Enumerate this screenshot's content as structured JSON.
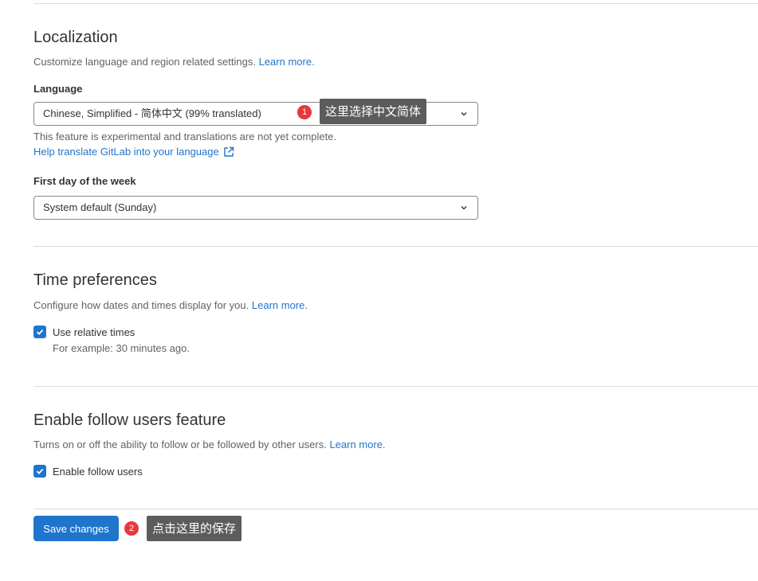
{
  "localization": {
    "title": "Localization",
    "description": "Customize language and region related settings.",
    "learn_more": "Learn more.",
    "language_label": "Language",
    "language_value": "Chinese, Simplified - 简体中文 (99% translated)",
    "experimental_note": "This feature is experimental and translations are not yet complete.",
    "help_translate": "Help translate GitLab into your language",
    "first_day_label": "First day of the week",
    "first_day_value": "System default (Sunday)"
  },
  "time_preferences": {
    "title": "Time preferences",
    "description": "Configure how dates and times display for you.",
    "learn_more": "Learn more.",
    "relative_times_label": "Use relative times",
    "relative_times_checked": true,
    "relative_times_example": "For example: 30 minutes ago."
  },
  "follow_users": {
    "title": "Enable follow users feature",
    "description": "Turns on or off the ability to follow or be followed by other users.",
    "learn_more": "Learn more.",
    "enable_label": "Enable follow users",
    "enable_checked": true
  },
  "save_button": "Save changes",
  "annotations": [
    {
      "number": "1",
      "text": "这里选择中文简体"
    },
    {
      "number": "2",
      "text": "点击这里的保存"
    }
  ],
  "colors": {
    "accent": "#1f75cb",
    "badge": "#e8383d",
    "tooltip": "#5c5c5c"
  }
}
